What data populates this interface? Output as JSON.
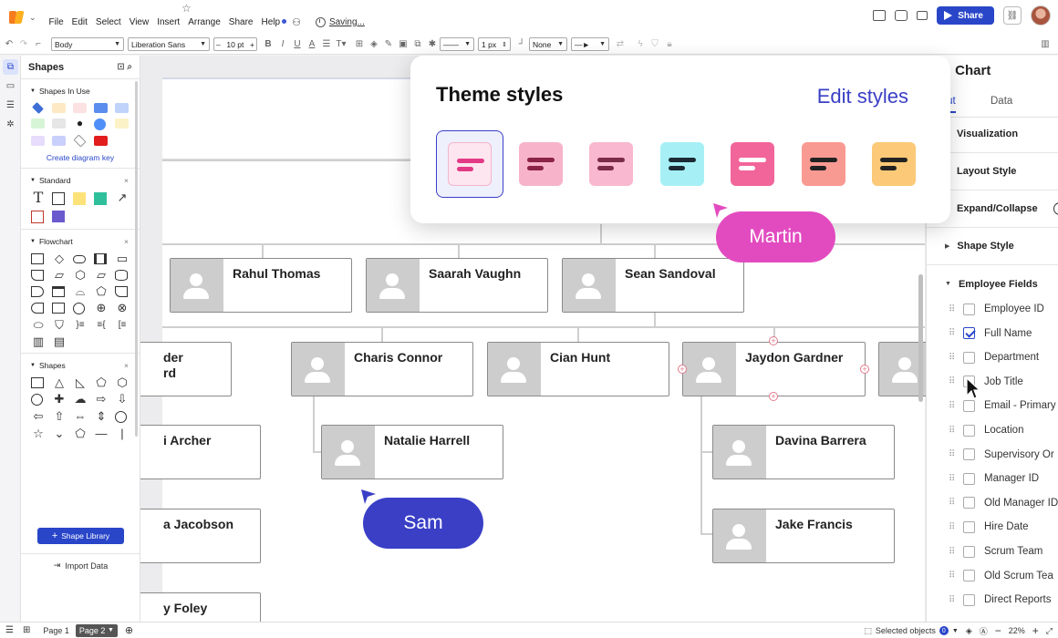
{
  "menu": {
    "items": [
      "File",
      "Edit",
      "Select",
      "View",
      "Insert",
      "Arrange",
      "Share",
      "Help"
    ],
    "saving": "Saving...",
    "share_label": "Share"
  },
  "toolbar": {
    "style_select": "Body",
    "font_select": "Liberation Sans",
    "font_size": "10 pt",
    "bold": "B",
    "italic": "I",
    "underline": "U",
    "text_color": "A",
    "line_width": "1 px",
    "arrow_start": "None"
  },
  "shapes_panel": {
    "title": "Shapes",
    "in_use_title": "Shapes In Use",
    "create_key": "Create diagram key",
    "standard_title": "Standard",
    "flowchart_title": "Flowchart",
    "shapes_title": "Shapes",
    "shape_library": "Shape Library",
    "import_data": "Import Data",
    "swatches": [
      "#3d6fd6",
      "#fde9c4",
      "#fbe1e1",
      "#5b8def",
      "#bfd3fb",
      "#d6f5d6",
      "#e6e6e6",
      "#222222",
      "#4f8ff7",
      "#fbf3c7",
      "#e7dcfb",
      "#c9d0fb",
      "#ffffff",
      "#e11d1d"
    ]
  },
  "canvas": {
    "cards": [
      {
        "name": "Rahul Thomas"
      },
      {
        "name": "Saarah Vaughn"
      },
      {
        "name": "Sean Sandoval"
      },
      {
        "name": "der\nrd"
      },
      {
        "name": "Charis Connor"
      },
      {
        "name": "Cian Hunt"
      },
      {
        "name": "Jaydon Gardner"
      },
      {
        "name": "i Archer"
      },
      {
        "name": "Natalie Harrell"
      },
      {
        "name": "Davina Barrera"
      },
      {
        "name": "a Jacobson"
      },
      {
        "name": "Jake Francis"
      },
      {
        "name": "y Foley"
      }
    ]
  },
  "theme_popup": {
    "title": "Theme styles",
    "edit": "Edit styles",
    "themes": [
      {
        "bg": "#fde6ef",
        "bar": "#e33a86"
      },
      {
        "bg": "#f7b3c9",
        "bar": "#8a2345"
      },
      {
        "bg": "#f9b8cf",
        "bar": "#7a2b47"
      },
      {
        "bg": "#a6f0f5",
        "bar": "#1b2a33"
      },
      {
        "bg": "#f2659a",
        "bar": "#ffffff"
      },
      {
        "bg": "#f99a92",
        "bar": "#222222"
      },
      {
        "bg": "#fbc977",
        "bar": "#222222"
      }
    ]
  },
  "collaborators": [
    {
      "name": "Martin",
      "color": "#e24bc0"
    },
    {
      "name": "Sam",
      "color": "#3a3fc6"
    }
  ],
  "right_panel": {
    "title": "rg Chart",
    "tabs": [
      "yout",
      "Data"
    ],
    "sections": [
      "Visualization",
      "Layout Style",
      "Expand/Collapse",
      "Shape Style",
      "Employee Fields"
    ],
    "fields": [
      {
        "label": "Employee ID",
        "checked": false
      },
      {
        "label": "Full Name",
        "checked": true
      },
      {
        "label": "Department",
        "checked": false
      },
      {
        "label": "Job Title",
        "checked": false
      },
      {
        "label": "Email - Primary",
        "checked": false
      },
      {
        "label": "Location",
        "checked": false
      },
      {
        "label": "Supervisory Or",
        "checked": false
      },
      {
        "label": "Manager ID",
        "checked": false
      },
      {
        "label": "Old Manager ID",
        "checked": false
      },
      {
        "label": "Hire Date",
        "checked": false
      },
      {
        "label": "Scrum Team",
        "checked": false
      },
      {
        "label": "Old Scrum Tea",
        "checked": false
      },
      {
        "label": "Direct Reports",
        "checked": false
      }
    ]
  },
  "bottom": {
    "pages": [
      "Page 1",
      "Page 2"
    ],
    "selected_objects": "Selected objects",
    "selected_count": "0",
    "zoom": "22%"
  }
}
